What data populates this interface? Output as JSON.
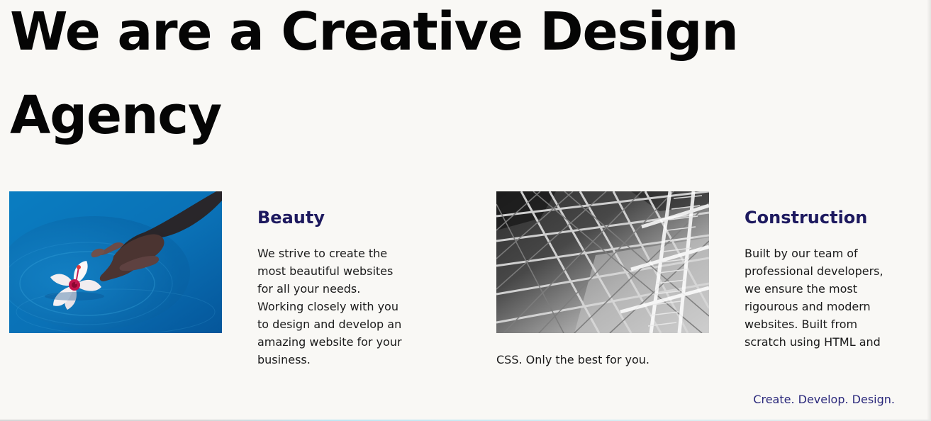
{
  "hero": {
    "title": "We are a Creative Design Agency"
  },
  "cards": [
    {
      "image_name": "flower-water-image",
      "title": "Beauty",
      "text": "We strive to create the most beautiful websites for all your needs. Working closely with you to design and develop an amazing website for your business."
    },
    {
      "image_name": "construction-steel-image",
      "title": "Construction",
      "text": "Built by our team of professional developers, we ensure the most rigourous and modern websites. Built from scratch using HTML and",
      "overflow_text": "CSS. Only the best for you."
    }
  ],
  "footer": {
    "tagline": "Create. Develop. Design."
  },
  "colors": {
    "background": "#f9f8f5",
    "heading": "#050505",
    "accent": "#1e1a5f",
    "tagline": "#2a287b"
  }
}
